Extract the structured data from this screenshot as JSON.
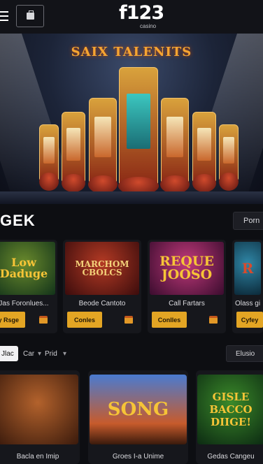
{
  "header": {
    "logo": "f123",
    "logo_sub": "casino",
    "menu_icon": "hamburger-menu-icon",
    "box_icon": "wallet-icon"
  },
  "hero": {
    "title": "SAIX TALENITS"
  },
  "section_one": {
    "title": "GEK",
    "pill_label": "Porn",
    "games": [
      {
        "art_text": "Low Daduge",
        "name": "Jas Foronlues...",
        "cta": "ly Rsge"
      },
      {
        "art_text": "MARCHOM CBOLCS",
        "name": "Beode Cantoto",
        "cta": "Conles"
      },
      {
        "art_text": "REQUE JOOSO",
        "name": "Call Fartars",
        "cta": "Conlles"
      },
      {
        "art_text": "R",
        "name": "Olass gi",
        "cta": "Cyfey"
      }
    ]
  },
  "filters": {
    "active": "Jlac",
    "items": [
      "Car",
      "Prid"
    ],
    "right_label": "Elusio"
  },
  "section_two": {
    "games": [
      {
        "art_text": "",
        "name": "Bacla en Imip"
      },
      {
        "art_text": "SONG",
        "name": "Groes I-a Unime"
      },
      {
        "art_text": "GISLE BACCO DIIGE!",
        "name": "Gedas Cangeu"
      }
    ]
  },
  "colors": {
    "accent": "#e3a524",
    "background": "#0d0e12",
    "card": "#16171c"
  }
}
